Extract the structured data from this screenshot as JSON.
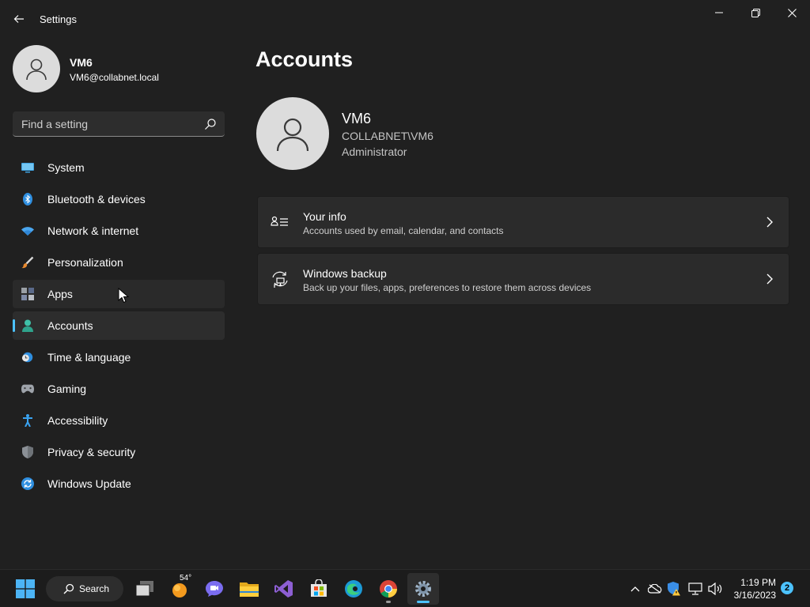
{
  "window": {
    "title": "Settings"
  },
  "profile": {
    "name": "VM6",
    "email": "VM6@collabnet.local"
  },
  "search": {
    "placeholder": "Find a setting"
  },
  "sidebar": {
    "items": [
      {
        "label": "System",
        "icon": "system-icon"
      },
      {
        "label": "Bluetooth & devices",
        "icon": "bluetooth-icon"
      },
      {
        "label": "Network & internet",
        "icon": "wifi-icon"
      },
      {
        "label": "Personalization",
        "icon": "brush-icon"
      },
      {
        "label": "Apps",
        "icon": "apps-icon"
      },
      {
        "label": "Accounts",
        "icon": "accounts-icon"
      },
      {
        "label": "Time & language",
        "icon": "time-language-icon"
      },
      {
        "label": "Gaming",
        "icon": "gamepad-icon"
      },
      {
        "label": "Accessibility",
        "icon": "accessibility-icon"
      },
      {
        "label": "Privacy & security",
        "icon": "shield-icon"
      },
      {
        "label": "Windows Update",
        "icon": "windows-update-icon"
      }
    ],
    "active": "Accounts",
    "hovered": "Apps"
  },
  "main": {
    "title": "Accounts",
    "account": {
      "name": "VM6",
      "domain": "COLLABNET\\VM6",
      "role": "Administrator"
    },
    "cards": [
      {
        "title": "Your info",
        "subtitle": "Accounts used by email, calendar, and contacts",
        "icon": "your-info-icon"
      },
      {
        "title": "Windows backup",
        "subtitle": "Back up your files, apps, preferences to restore them across devices",
        "icon": "backup-icon"
      }
    ]
  },
  "taskbar": {
    "search_label": "Search",
    "weather_temp": "54°",
    "clock_time": "1:19 PM",
    "clock_date": "3/16/2023",
    "notification_count": "2"
  },
  "colors": {
    "accent": "#4cc2ff",
    "background": "#202020",
    "card": "#2b2b2b"
  }
}
